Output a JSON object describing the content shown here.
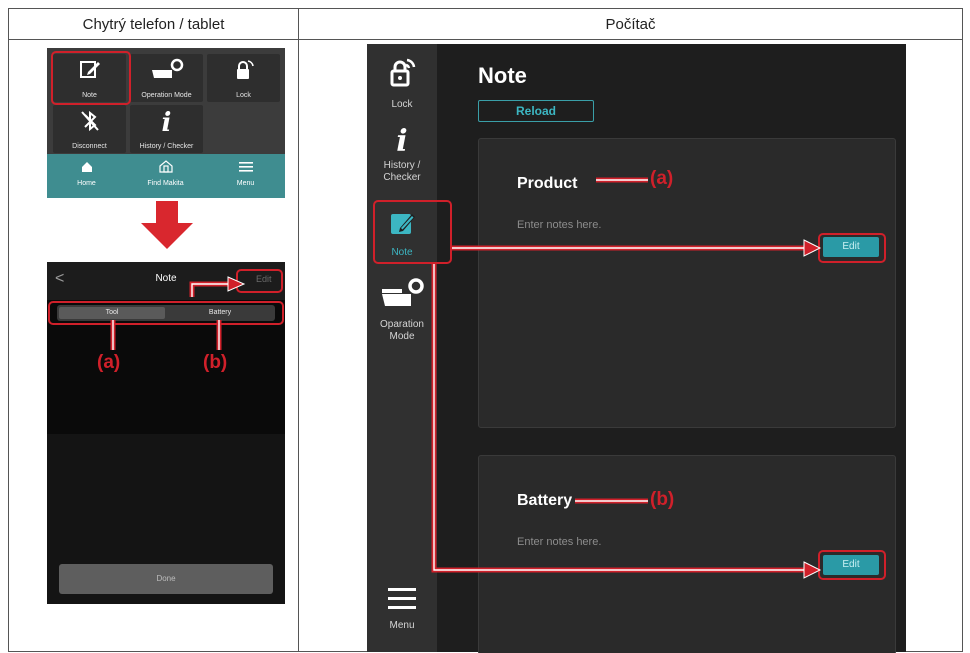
{
  "headers": {
    "left": "Chytrý telefon / tablet",
    "right": "Počítač"
  },
  "phone_menu": {
    "tiles": [
      {
        "label": "Note",
        "icon": "note-edit-icon",
        "glyph": "✎"
      },
      {
        "label": "Operation Mode",
        "icon": "operation-mode-icon",
        "glyph": "⚙"
      },
      {
        "label": "Lock",
        "icon": "lock-wireless-icon",
        "glyph": "🔒"
      },
      {
        "label": "Disconnect",
        "icon": "bluetooth-off-icon",
        "glyph": "✕"
      },
      {
        "label": "History / Checker",
        "icon": "info-icon",
        "glyph": "i"
      }
    ],
    "nav": [
      {
        "label": "Home",
        "icon": "home-icon",
        "glyph": "⌂"
      },
      {
        "label": "Find Makita",
        "icon": "find-makita-icon",
        "glyph": "⌂"
      },
      {
        "label": "Menu",
        "icon": "menu-icon",
        "glyph": "≡"
      }
    ]
  },
  "phone_note": {
    "back": "<",
    "title": "Note",
    "edit": "Edit",
    "segments": [
      "Tool",
      "Battery"
    ],
    "done": "Done"
  },
  "desktop": {
    "sidebar": [
      {
        "label": "Lock",
        "icon": "lock-wireless-icon",
        "glyph": "⌂"
      },
      {
        "label": "History /\nChecker",
        "icon": "info-icon",
        "glyph": "i"
      },
      {
        "label": "Note",
        "icon": "note-edit-icon",
        "glyph": "✎"
      },
      {
        "label": "Oparation\nMode",
        "icon": "operation-mode-icon",
        "glyph": "⚙"
      },
      {
        "label": "Menu",
        "icon": "menu-icon",
        "glyph": "≡"
      }
    ],
    "title": "Note",
    "reload": "Reload",
    "cards": [
      {
        "heading": "Product",
        "placeholder": "Enter notes here.",
        "edit": "Edit"
      },
      {
        "heading": "Battery",
        "placeholder": "Enter notes here.",
        "edit": "Edit"
      }
    ]
  },
  "annotations": {
    "a": "(a)",
    "b": "(b)"
  },
  "colors": {
    "accent": "#3cb6c2",
    "highlight": "#d0202a",
    "nav_teal": "#3f8d90"
  }
}
